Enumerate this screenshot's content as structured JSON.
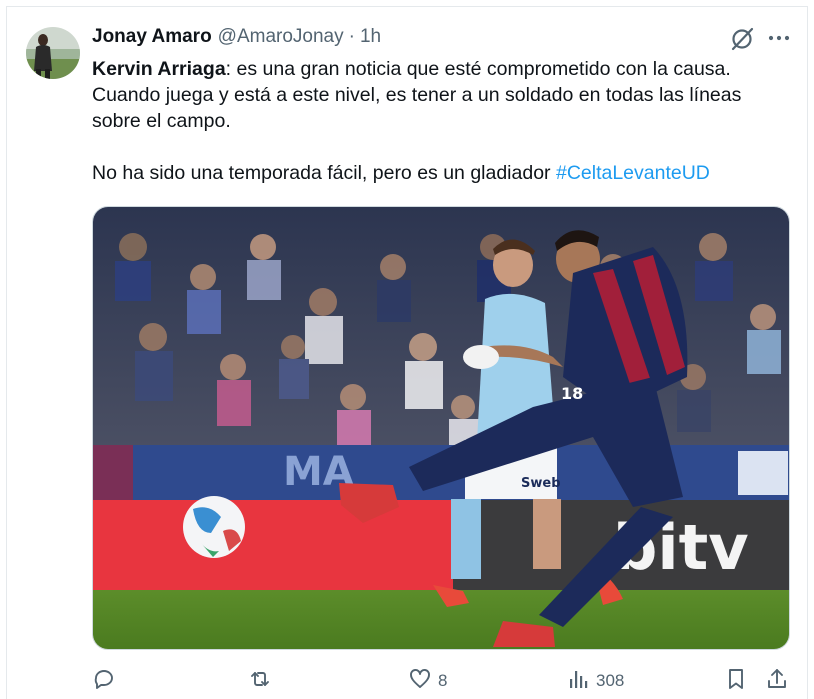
{
  "tweet": {
    "author_name": "Jonay Amaro",
    "author_handle": "@AmaroJonay",
    "separator": "·",
    "timestamp": "1h",
    "mention": "Kervin Arriaga",
    "line1_rest": ": es una gran noticia que esté comprometido con la causa.",
    "line2": "Cuando juega y está a este nivel, es tener a un soldado en todas las líneas",
    "line3": "sobre el campo.",
    "line4": "No ha sido una temporada fácil, pero es un gladiador ",
    "hashtag": "#CeltaLevanteUD"
  },
  "media": {
    "board_text_left": "MA",
    "board_text_right": "bitv",
    "shorts_sponsor": "Sweb",
    "shirt_number": "18"
  },
  "actions": {
    "reply_icon": "reply-icon",
    "repost_icon": "repost-icon",
    "like_icon": "heart-icon",
    "like_count": "8",
    "views_icon": "views-icon",
    "views_count": "308",
    "bookmark_icon": "bookmark-icon",
    "share_icon": "share-icon"
  },
  "colors": {
    "text": "#0f1419",
    "secondary": "#536471",
    "link": "#1d9bf0",
    "border": "#cfd9de"
  }
}
